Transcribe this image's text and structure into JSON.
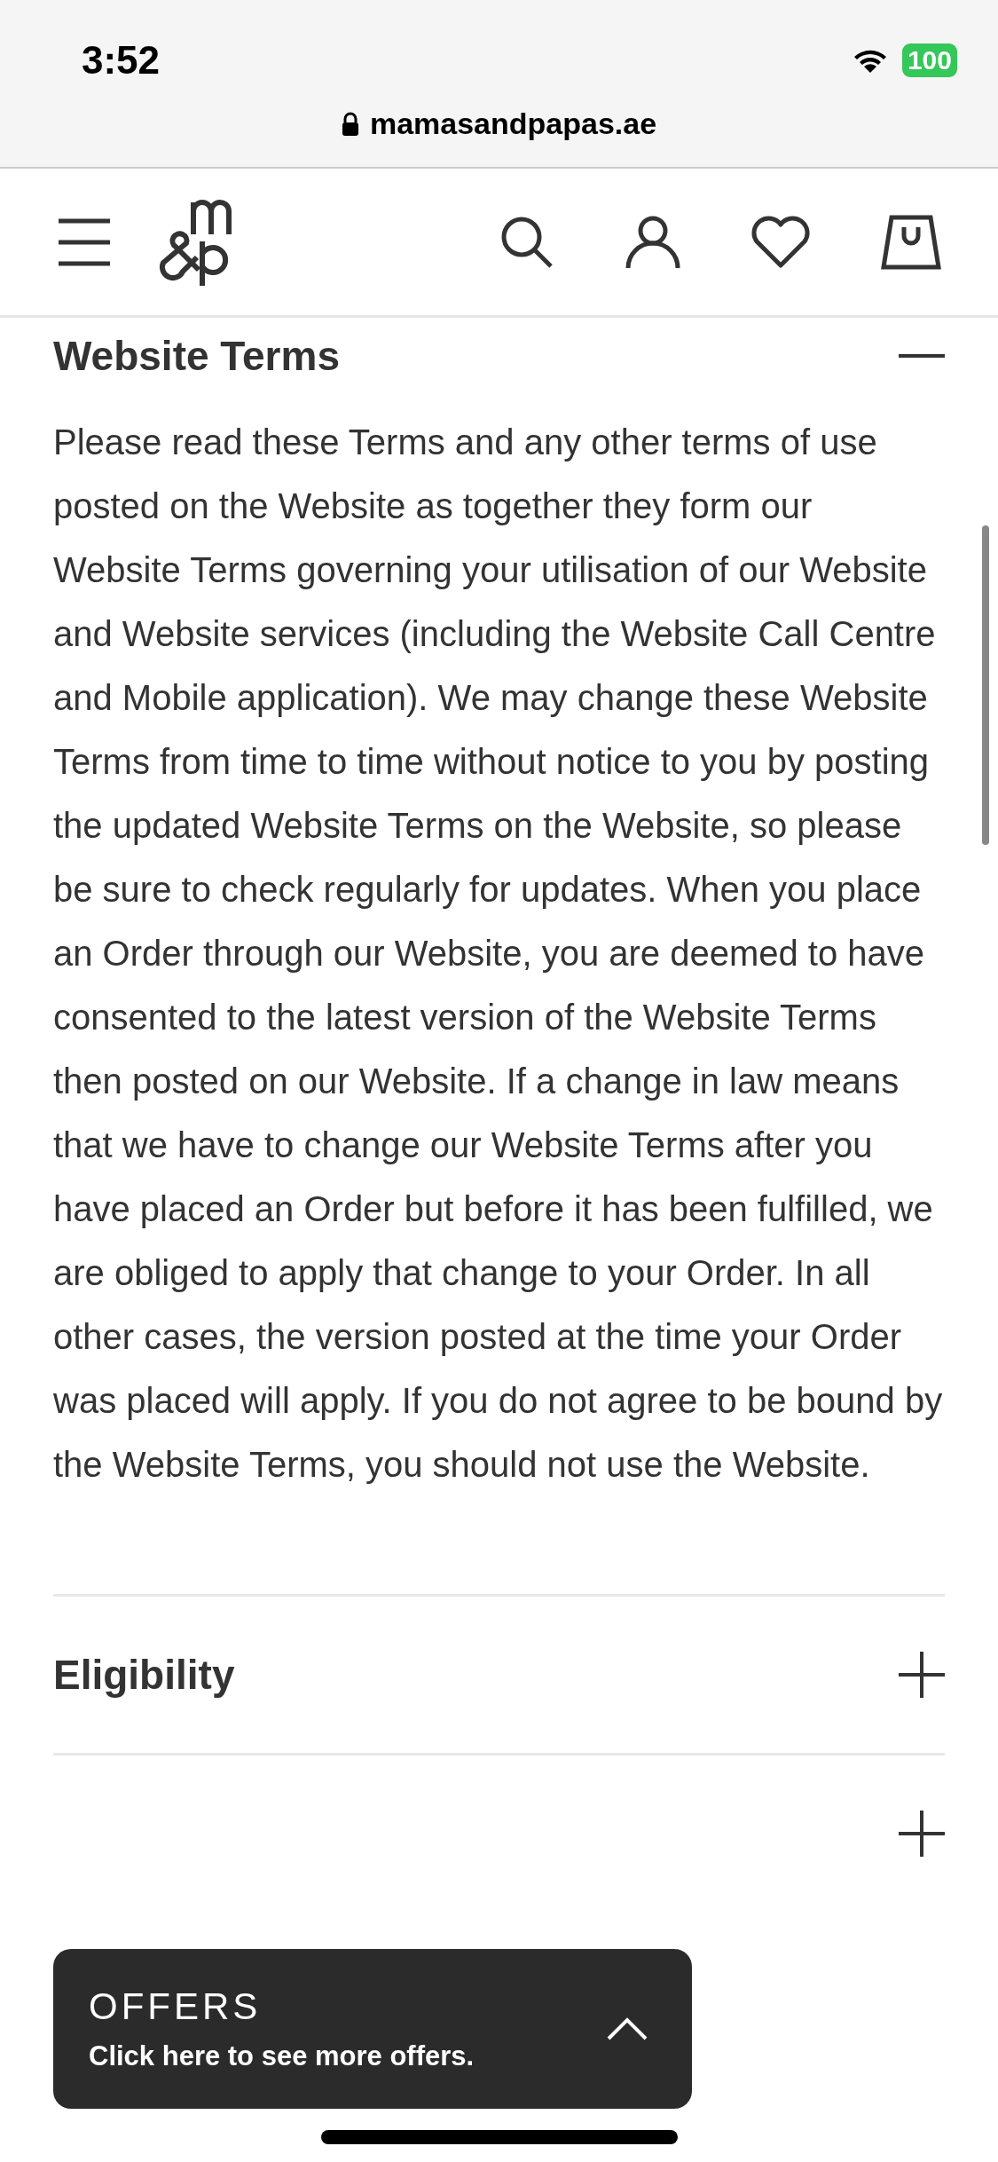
{
  "status_bar": {
    "time": "3:52",
    "battery": "100"
  },
  "browser": {
    "url": "mamasandpapas.ae"
  },
  "sections": [
    {
      "title": "Website Terms",
      "expanded": true,
      "body": "Please read these Terms and any other terms of use posted on the Website as together they form our Website Terms governing your utilisation of our Website and Website services (including the Website Call Centre and Mobile application). We may change these Website Terms from time to time without notice to you by posting the updated Website Terms on the Website, so please be sure to check regularly for updates. When you place an Order through our Website, you are deemed to have consented to the latest version of the Website Terms then posted on our Website. If a change in law means that we have to change our Website Terms after you have placed an Order but before it has been fulfilled, we are obliged to apply that change to your Order. In all other cases, the version posted at the time your Order was placed will apply. If you do not agree to be bound by the Website Terms, you should not use the Website."
    },
    {
      "title": "Eligibility",
      "expanded": false
    },
    {
      "expanded": false
    }
  ],
  "offers": {
    "title": "OFFERS",
    "text": "Click here to see more offers."
  }
}
